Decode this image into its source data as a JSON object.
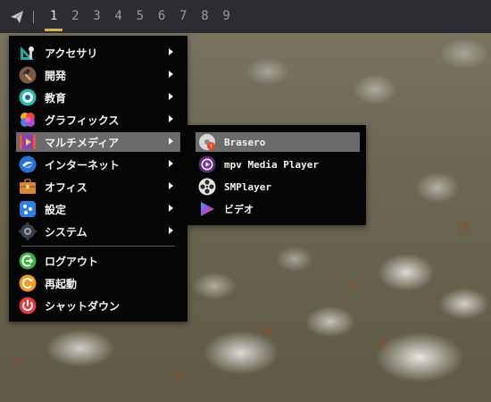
{
  "panel": {
    "launcher_icon": "paper-plane-icon",
    "workspaces": [
      "1",
      "2",
      "3",
      "4",
      "5",
      "6",
      "7",
      "8",
      "9"
    ],
    "active_workspace": "1",
    "accent": "#d6b35a"
  },
  "main_menu": {
    "items": [
      {
        "label": "アクセサリ",
        "icon": "accessories-icon"
      },
      {
        "label": "開発",
        "icon": "development-hammer-icon"
      },
      {
        "label": "教育",
        "icon": "education-icon"
      },
      {
        "label": "グラフィックス",
        "icon": "graphics-icon"
      },
      {
        "label": "マルチメディア",
        "icon": "multimedia-icon"
      },
      {
        "label": "インターネット",
        "icon": "internet-icon"
      },
      {
        "label": "オフィス",
        "icon": "office-briefcase-icon"
      },
      {
        "label": "設定",
        "icon": "settings-icon"
      },
      {
        "label": "システム",
        "icon": "system-gear-icon"
      },
      {
        "label": "ログアウト",
        "icon": "logout-icon"
      },
      {
        "label": "再起動",
        "icon": "restart-icon"
      },
      {
        "label": "シャットダウン",
        "icon": "shutdown-icon"
      }
    ]
  },
  "sub_menu": {
    "items": [
      {
        "label": "Brasero",
        "icon": "brasero-disc-icon"
      },
      {
        "label": "mpv Media Player",
        "icon": "mpv-icon"
      },
      {
        "label": "SMPlayer",
        "icon": "smplayer-reel-icon"
      },
      {
        "label": "ビデオ",
        "icon": "video-play-icon"
      }
    ]
  }
}
